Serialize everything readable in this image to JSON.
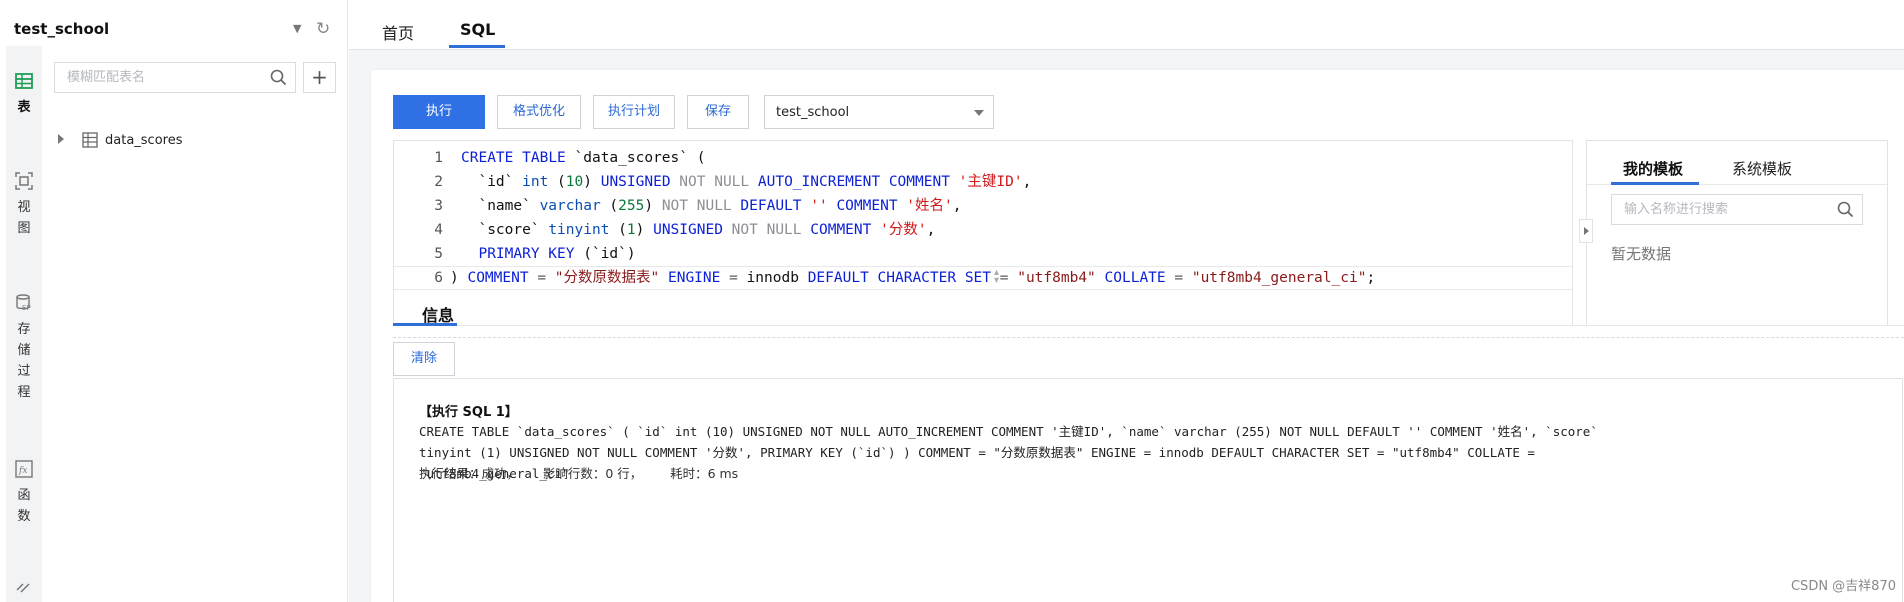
{
  "sidebar": {
    "database": "test_school",
    "nav": {
      "table": "表",
      "view": "视图",
      "procedure": "存储过程",
      "function": "函数"
    },
    "search_placeholder": "模糊匹配表名",
    "add_label": "+",
    "tables": [
      {
        "label": "data_scores"
      }
    ]
  },
  "top_tabs": {
    "home": "首页",
    "sql": "SQL"
  },
  "toolbar": {
    "run": "执行",
    "format": "格式优化",
    "plan": "执行计划",
    "save": "保存",
    "database_selected": "test_school"
  },
  "editor": {
    "line_numbers": [
      "1",
      "2",
      "3",
      "4",
      "5",
      "6"
    ]
  },
  "templates": {
    "tab_mine": "我的模板",
    "tab_system": "系统模板",
    "search_placeholder": "输入名称进行搜索",
    "empty": "暂无数据"
  },
  "info": {
    "tab": "信息",
    "clear": "清除",
    "result_title": "【执行 SQL 1】",
    "result_sql": "CREATE TABLE `data_scores` ( `id` int (10) UNSIGNED NOT NULL AUTO_INCREMENT COMMENT '主键ID', `name` varchar (255) NOT NULL DEFAULT '' COMMENT '姓名', `score` tinyint (1) UNSIGNED NOT NULL COMMENT '分数', PRIMARY KEY (`id`) ) COMMENT = \"分数原数据表\" ENGINE = innodb DEFAULT CHARACTER SET = \"utf8mb4\" COLLATE = \"utf8mb4_general_ci\"",
    "result_status": "执行结果：成功，      影响行数：0 行，       耗时：6 ms"
  },
  "watermark": "CSDN @吉祥870",
  "colors": {
    "accent": "#2f71e4",
    "keyword": "#0b1fd6",
    "string": "#d01a1a",
    "muted_keyword": "#8d8f94"
  }
}
